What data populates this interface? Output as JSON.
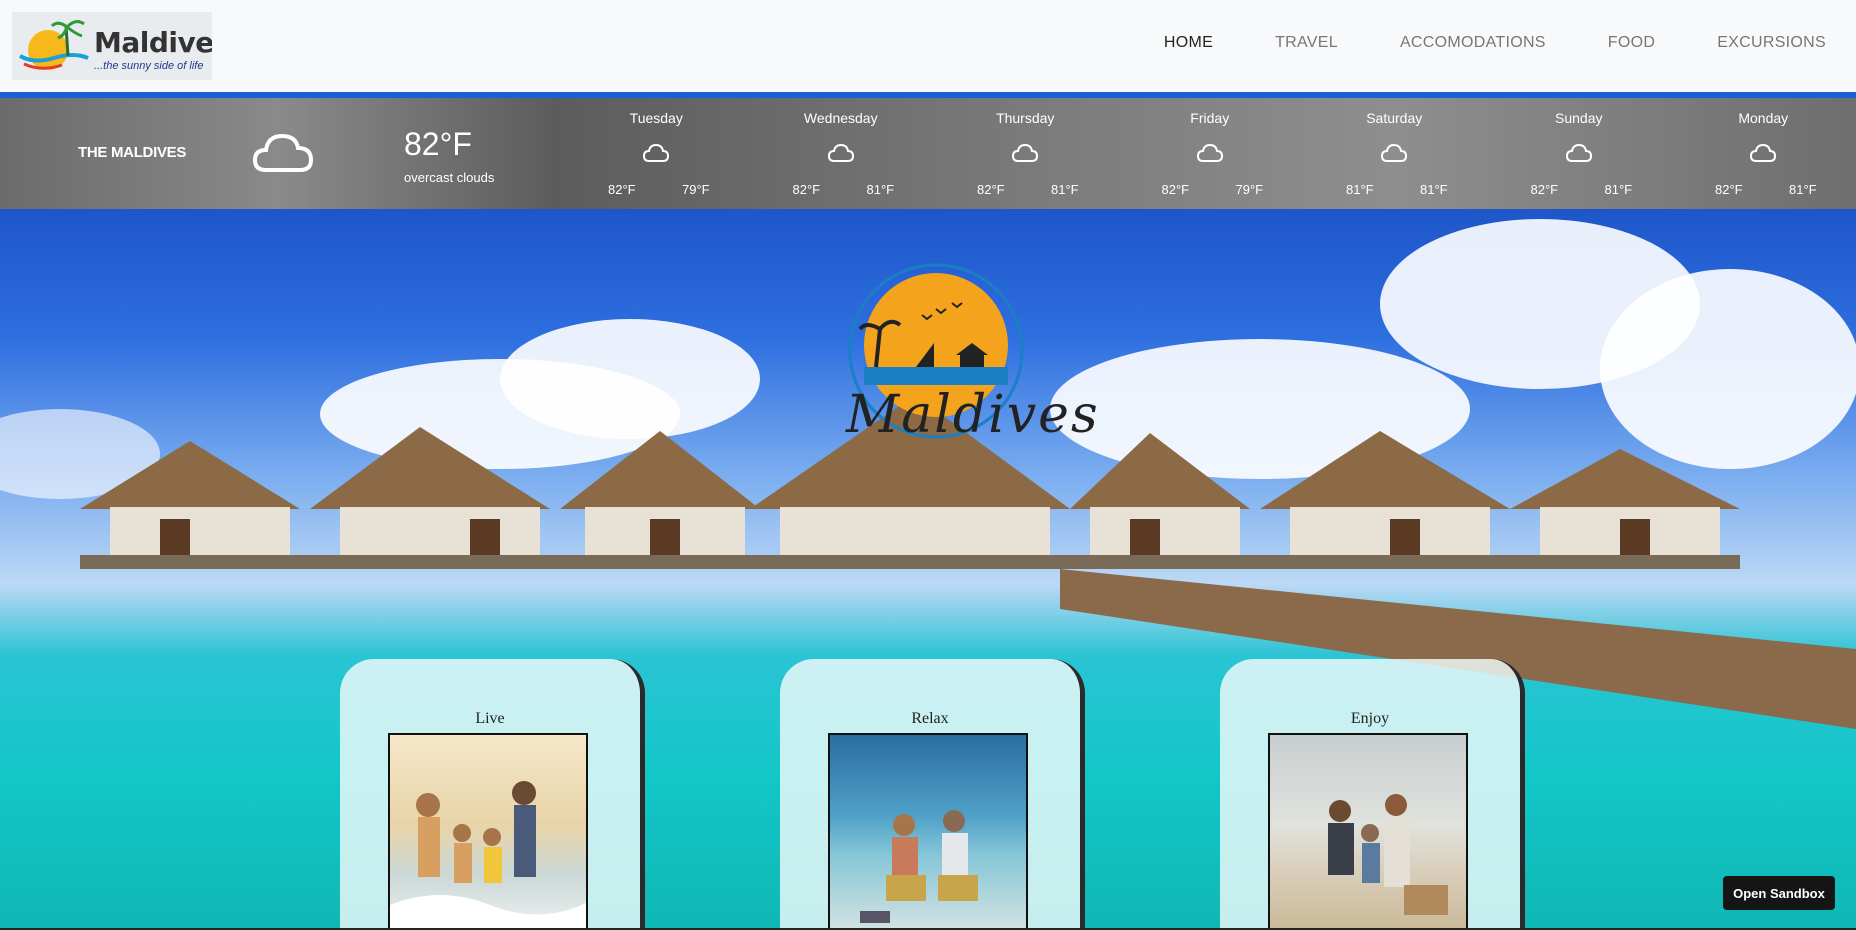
{
  "header": {
    "logo": {
      "word": "Maldives",
      "tagline": "...the sunny side of life"
    },
    "nav": [
      {
        "label": "HOME",
        "active": true
      },
      {
        "label": "TRAVEL",
        "active": false
      },
      {
        "label": "ACCOMODATIONS",
        "active": false
      },
      {
        "label": "FOOD",
        "active": false
      },
      {
        "label": "EXCURSIONS",
        "active": false
      }
    ]
  },
  "weather": {
    "location": "THE MALDIVES",
    "current_icon": "cloud-icon",
    "current_temp": "82°F",
    "condition": "overcast clouds",
    "forecast": [
      {
        "day": "Tuesday",
        "icon": "cloud-icon",
        "high": "82°F",
        "low": "79°F"
      },
      {
        "day": "Wednesday",
        "icon": "cloud-icon",
        "high": "82°F",
        "low": "81°F"
      },
      {
        "day": "Thursday",
        "icon": "cloud-icon",
        "high": "82°F",
        "low": "81°F"
      },
      {
        "day": "Friday",
        "icon": "cloud-icon",
        "high": "82°F",
        "low": "79°F"
      },
      {
        "day": "Saturday",
        "icon": "cloud-icon",
        "high": "81°F",
        "low": "81°F"
      },
      {
        "day": "Sunday",
        "icon": "cloud-icon",
        "high": "82°F",
        "low": "81°F"
      },
      {
        "day": "Monday",
        "icon": "cloud-icon",
        "high": "82°F",
        "low": "81°F"
      }
    ]
  },
  "hero": {
    "logo_text": "Maldives",
    "cards": [
      {
        "title": "Live"
      },
      {
        "title": "Relax"
      },
      {
        "title": "Enjoy"
      }
    ]
  },
  "sandbox_button": "Open Sandbox",
  "colors": {
    "accent_bar": "#1f5fd6",
    "sun_orange": "#f4a31c",
    "sea": "#13c7c8"
  }
}
